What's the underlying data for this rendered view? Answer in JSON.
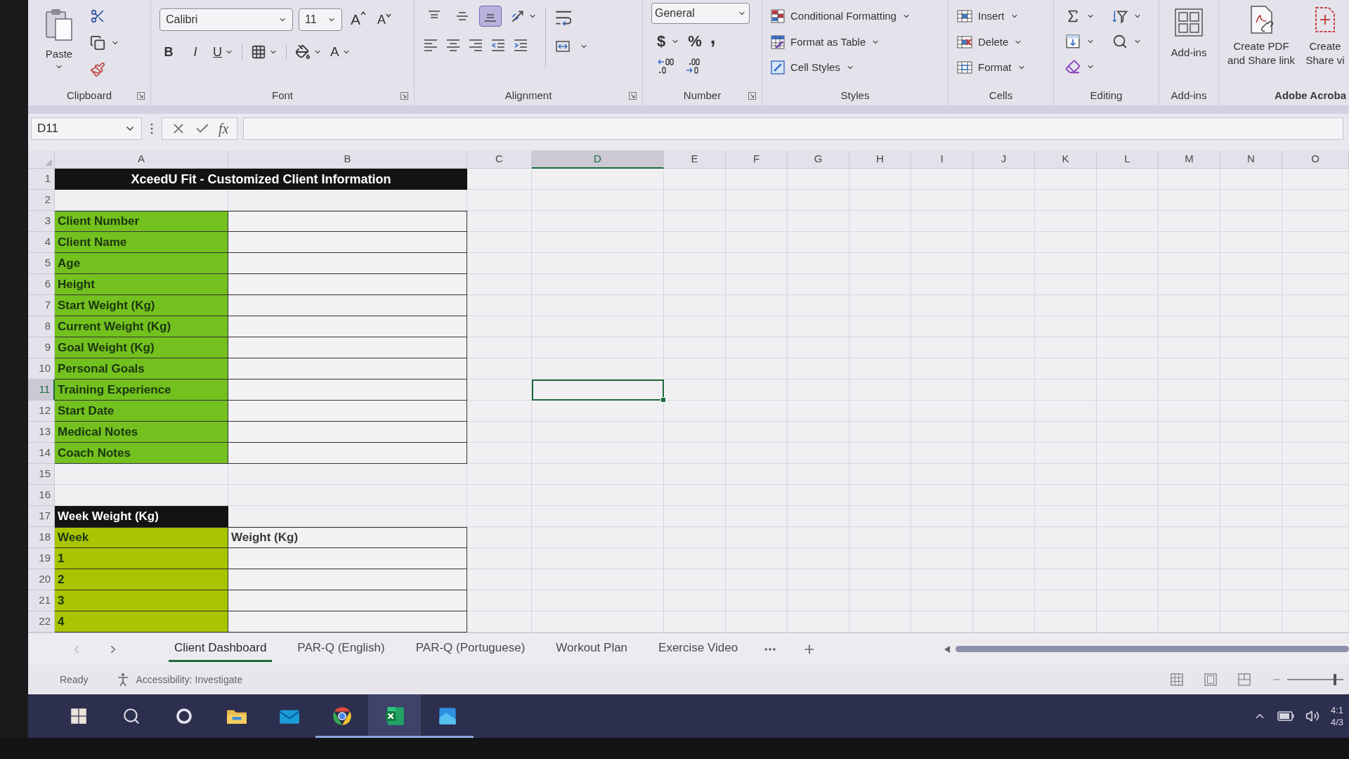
{
  "ribbon": {
    "clipboard": {
      "paste": "Paste",
      "label": "Clipboard"
    },
    "font": {
      "family": "Calibri",
      "size": "11",
      "grow": "A",
      "shrink": "A",
      "bold": "B",
      "italic": "I",
      "underline": "U",
      "color_label": "A",
      "label": "Font"
    },
    "alignment": {
      "vertical_align": [
        {
          "selected": false
        },
        {
          "selected": false
        },
        {
          "selected": true
        }
      ],
      "label": "Alignment"
    },
    "number": {
      "format": "General",
      "currency": "$",
      "percent": "%",
      "comma": ",",
      "label": "Number"
    },
    "styles": {
      "items": [
        "Conditional Formatting",
        "Format as Table",
        "Cell Styles"
      ],
      "label": "Styles"
    },
    "cells": {
      "items": [
        "Insert",
        "Delete",
        "Format"
      ],
      "label": "Cells"
    },
    "editing": {
      "label": "Editing"
    },
    "add_ins": {
      "button": "Add-ins",
      "label": "Add-ins"
    },
    "adobe": {
      "buttons": [
        "Create PDF and Share link",
        "Create Share vi"
      ],
      "label": "Adobe Acroba"
    }
  },
  "formula_bar": {
    "name_box": "D11",
    "function_label": "fx"
  },
  "sheet": {
    "columns": [
      {
        "label": "A",
        "selected": false
      },
      {
        "label": "B",
        "selected": false
      },
      {
        "label": "C",
        "selected": false
      },
      {
        "label": "D",
        "selected": true
      },
      {
        "label": "E",
        "selected": false
      },
      {
        "label": "F",
        "selected": false
      },
      {
        "label": "G",
        "selected": false
      },
      {
        "label": "H",
        "selected": false
      },
      {
        "label": "I",
        "selected": false
      },
      {
        "label": "J",
        "selected": false
      },
      {
        "label": "K",
        "selected": false
      },
      {
        "label": "L",
        "selected": false
      },
      {
        "label": "M",
        "selected": false
      },
      {
        "label": "N",
        "selected": false
      },
      {
        "label": "O",
        "selected": false
      }
    ],
    "rows": [
      {
        "number": "1",
        "selected": false,
        "kind": "title",
        "text": "XceedU Fit - Customized Client Information"
      },
      {
        "number": "2",
        "selected": false,
        "kind": "blank"
      },
      {
        "number": "3",
        "selected": false,
        "kind": "field",
        "label": "Client Number"
      },
      {
        "number": "4",
        "selected": false,
        "kind": "field",
        "label": "Client Name"
      },
      {
        "number": "5",
        "selected": false,
        "kind": "field",
        "label": "Age"
      },
      {
        "number": "6",
        "selected": false,
        "kind": "field",
        "label": "Height"
      },
      {
        "number": "7",
        "selected": false,
        "kind": "field",
        "label": "Start Weight (Kg)"
      },
      {
        "number": "8",
        "selected": false,
        "kind": "field",
        "label": "Current Weight (Kg)"
      },
      {
        "number": "9",
        "selected": false,
        "kind": "field",
        "label": "Goal Weight (Kg)"
      },
      {
        "number": "10",
        "selected": false,
        "kind": "field",
        "label": "Personal Goals"
      },
      {
        "number": "11",
        "selected": true,
        "kind": "field",
        "label": "Training Experience"
      },
      {
        "number": "12",
        "selected": false,
        "kind": "field",
        "label": "Start Date"
      },
      {
        "number": "13",
        "selected": false,
        "kind": "field",
        "label": "Medical Notes"
      },
      {
        "number": "14",
        "selected": false,
        "kind": "field",
        "label": "Coach Notes"
      },
      {
        "number": "15",
        "selected": false,
        "kind": "blank"
      },
      {
        "number": "16",
        "selected": false,
        "kind": "blank"
      },
      {
        "number": "17",
        "selected": false,
        "kind": "section",
        "text": "Week Weight (Kg)"
      },
      {
        "number": "18",
        "selected": false,
        "kind": "week",
        "label": "Week",
        "value": "Weight (Kg)"
      },
      {
        "number": "19",
        "selected": false,
        "kind": "week",
        "label": "1"
      },
      {
        "number": "20",
        "selected": false,
        "kind": "week",
        "label": "2"
      },
      {
        "number": "21",
        "selected": false,
        "kind": "week",
        "label": "3"
      },
      {
        "number": "22",
        "selected": false,
        "kind": "week",
        "label": "4"
      }
    ]
  },
  "sheet_tabs": {
    "tabs": [
      {
        "label": "Client Dashboard",
        "selected": true
      },
      {
        "label": "PAR-Q (English)",
        "selected": false
      },
      {
        "label": "PAR-Q (Portuguese)",
        "selected": false
      },
      {
        "label": "Workout Plan",
        "selected": false
      },
      {
        "label": "Exercise Video",
        "selected": false
      }
    ]
  },
  "status_bar": {
    "status": "Ready",
    "accessibility": "Accessibility: Investigate",
    "zoom": {
      "level": 0.85
    }
  },
  "taskbar": {
    "items": [
      {
        "kind": "start",
        "running": false,
        "selected": false
      },
      {
        "kind": "search",
        "running": false,
        "selected": false
      },
      {
        "kind": "assistant",
        "running": false,
        "selected": false
      },
      {
        "kind": "folder",
        "running": false,
        "selected": false
      },
      {
        "kind": "mail",
        "running": false,
        "selected": false
      },
      {
        "kind": "browser",
        "running": true,
        "selected": false
      },
      {
        "kind": "spreadsheet",
        "running": true,
        "selected": true
      },
      {
        "kind": "app",
        "running": true,
        "selected": false
      }
    ],
    "clock": {
      "time": "4:1",
      "date": "4/3"
    }
  }
}
